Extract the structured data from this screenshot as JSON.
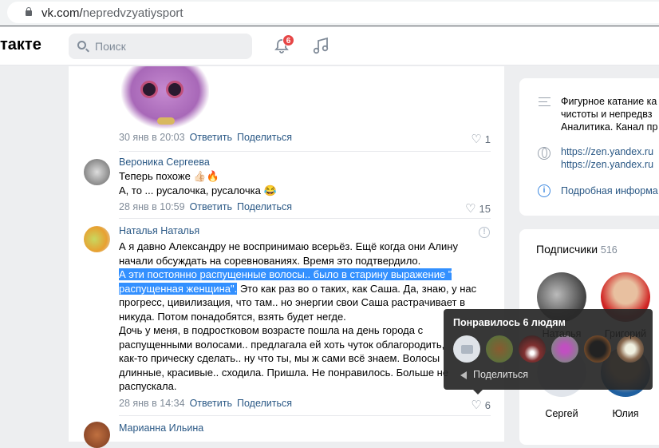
{
  "browser": {
    "url_host": "vk.com/",
    "url_path": "nepredvzyatiysport"
  },
  "header": {
    "logo": "такте",
    "search_placeholder": "Поиск",
    "notifications_count": "6"
  },
  "comments": [
    {
      "date": "30 янв в 20:03",
      "reply": "Ответить",
      "share": "Поделиться",
      "likes": "1"
    },
    {
      "author": "Вероника Сергеева",
      "lines": [
        "Теперь похоже 👍🏻🔥",
        "А, то ... русалочка, русалочка 😂"
      ],
      "date": "28 янв в 10:59",
      "reply": "Ответить",
      "share": "Поделиться",
      "likes": "15"
    },
    {
      "author": "Наталья Наталья",
      "line1": "А я давно Александру не воспринимаю всерьёз. Ещё когда они Алину",
      "line2": "начали обсуждать на соревнованиях. Время это подтвердило.",
      "sel1": "А эти постоянно распущенные волосы.. было в старину выражение \"",
      "sel2": "распущенная женщина\".",
      "line4rest": " Это как раз во о таких, как Саша. Да, знаю, у нас",
      "line5": "прогресс, цивилизация, что там.. но энергии свои Саша растрачивает в",
      "line6": "никуда. Потом понадобятся, взять будет негде.",
      "line7": "Дочь у меня, в подростковом возрасте пошла на день города с",
      "line8": "распущенными волосами.. предлагала ей хоть чуток облагородить,",
      "line9": "как-то прическу сделать.. ну что ты, мы ж сами всё знаем. Волосы",
      "line10": "длинные, красивые.. сходила. Пришла. Не понравилось. Больше не",
      "line11": "распускала.",
      "date": "28 янв в 14:34",
      "reply": "Ответить",
      "share": "Поделиться",
      "likes": "6"
    },
    {
      "author": "Марианна Ильина"
    }
  ],
  "info_card": {
    "description": [
      "Фигурное катание ка",
      "чистоты и непредвз",
      "Аналитика. Канал пр"
    ],
    "links": [
      "https://zen.yandex.ru",
      "https://zen.yandex.ru"
    ],
    "more": "Подробная информа"
  },
  "subscribers": {
    "title": "Подписчики",
    "count": "516",
    "people": [
      "Наталья",
      "Григорий",
      "Сергей",
      "Юлия"
    ]
  },
  "likes_tooltip": {
    "title": "Понравилось 6 людям",
    "share": "Поделиться"
  }
}
